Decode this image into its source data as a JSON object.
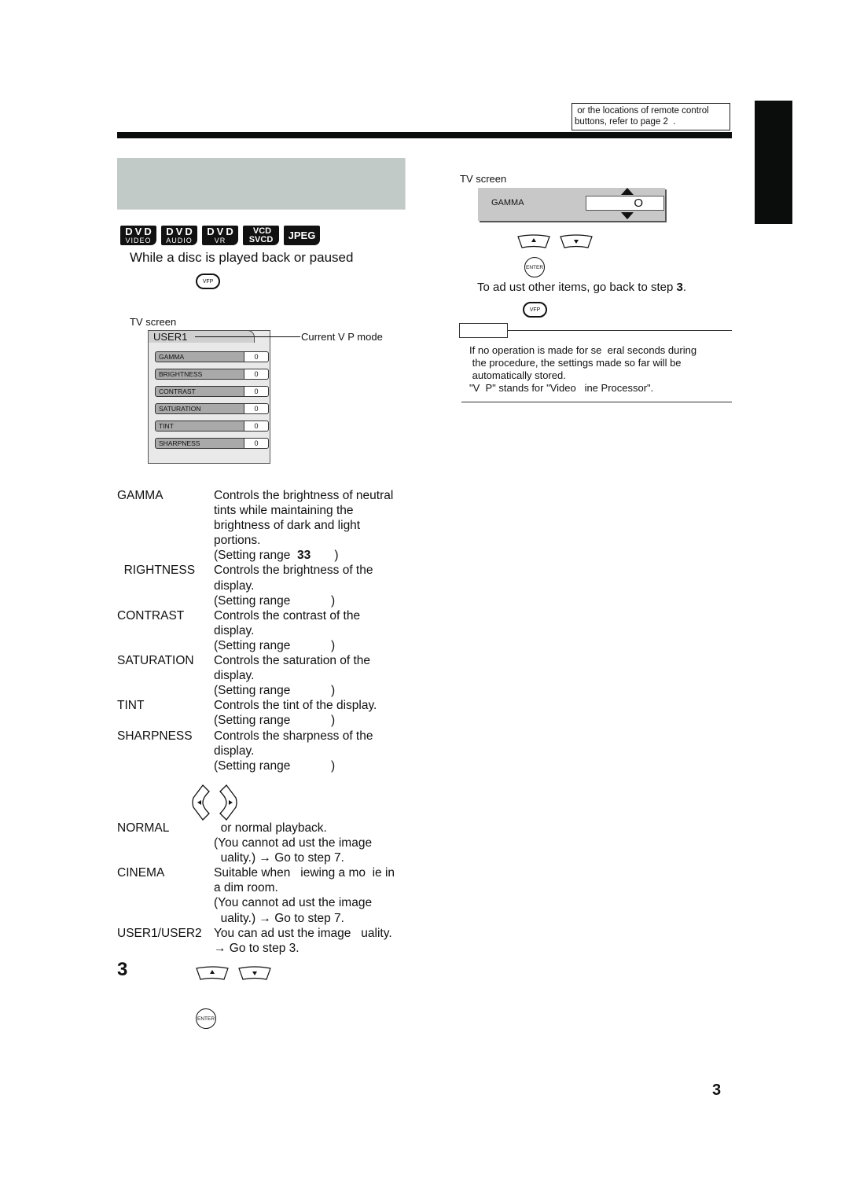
{
  "header": {
    "reference_note": [
      " or the locations of remote control",
      "buttons, refer to page 2  ."
    ],
    "title_band": ""
  },
  "disc_badges": [
    {
      "top": "DVD",
      "bottom": "VIDEO"
    },
    {
      "top": "DVD",
      "bottom": "AUDIO"
    },
    {
      "top": "DVD",
      "bottom": "VR"
    },
    {
      "top": "VCD",
      "bottom": "SVCD"
    },
    {
      "top": "JPEG",
      "bottom": ""
    }
  ],
  "left": {
    "condition": "While a disc is played back or paused",
    "vfp_button": "VFP",
    "tv_screen_label": "TV screen",
    "menu": {
      "mode": "USER1",
      "callout": "Current V  P mode",
      "items": [
        {
          "label": "GAMMA",
          "value": "0"
        },
        {
          "label": "BRIGHTNESS",
          "value": "0"
        },
        {
          "label": "CONTRAST",
          "value": "0"
        },
        {
          "label": "SATURATION",
          "value": "0"
        },
        {
          "label": "TINT",
          "value": "0"
        },
        {
          "label": "SHARPNESS",
          "value": "0"
        }
      ]
    },
    "definitions": [
      {
        "term": "GAMMA",
        "lines": [
          "Controls the brightness of neutral",
          "tints while maintaining the",
          "brightness of dark and light",
          "portions."
        ],
        "range_prefix": "(Setting range  ",
        "range_bold": "33",
        "range_suffix": "       )"
      },
      {
        "term": "  RIGHTNESS",
        "lines": [
          "Controls the brightness of the",
          "display."
        ],
        "range_prefix": "(Setting range            )",
        "range_bold": "",
        "range_suffix": ""
      },
      {
        "term": "CONTRAST",
        "lines": [
          "Controls the contrast of the",
          "display."
        ],
        "range_prefix": "(Setting range            )",
        "range_bold": "",
        "range_suffix": ""
      },
      {
        "term": "SATURATION",
        "lines": [
          "Controls the saturation of the",
          "display."
        ],
        "range_prefix": "(Setting range            )",
        "range_bold": "",
        "range_suffix": ""
      },
      {
        "term": "TINT",
        "lines": [
          "Controls the tint of the display."
        ],
        "range_prefix": "(Setting range            )",
        "range_bold": "",
        "range_suffix": ""
      },
      {
        "term": "SHARPNESS",
        "lines": [
          "Controls the sharpness of the",
          "display."
        ],
        "range_prefix": "(Setting range            )",
        "range_bold": "",
        "range_suffix": ""
      }
    ],
    "modes": [
      {
        "term": "NORMAL",
        "lines": [
          "  or normal playback.",
          "(You cannot ad ust the image",
          "  uality.) → Go to step 7."
        ]
      },
      {
        "term": "CINEMA",
        "lines": [
          "Suitable when   iewing a mo  ie in",
          "a dim room.",
          "(You cannot ad ust the image",
          "  uality.) → Go to step 7."
        ]
      },
      {
        "term": "USER1/USER2",
        "lines": [
          "You can ad ust the image   uality.",
          "→ Go to step 3."
        ]
      }
    ],
    "step_number": "3",
    "enter_button": "ENTER"
  },
  "right": {
    "tv_screen_label": "TV screen",
    "gamma_label": "GAMMA",
    "gamma_value": "O",
    "enter_button": "ENTER",
    "instruction_prefix": "To ad ust other items, go back to step  ",
    "instruction_step": "3",
    "instruction_suffix": ".",
    "vfp_button": "VFP",
    "notes": [
      "If no operation is made for se  eral seconds during",
      " the procedure, the settings made so far will be",
      " automatically stored.",
      "\"V  P\" stands for \"Video   ine Processor\"."
    ]
  },
  "footer": {
    "page_number": "3"
  }
}
